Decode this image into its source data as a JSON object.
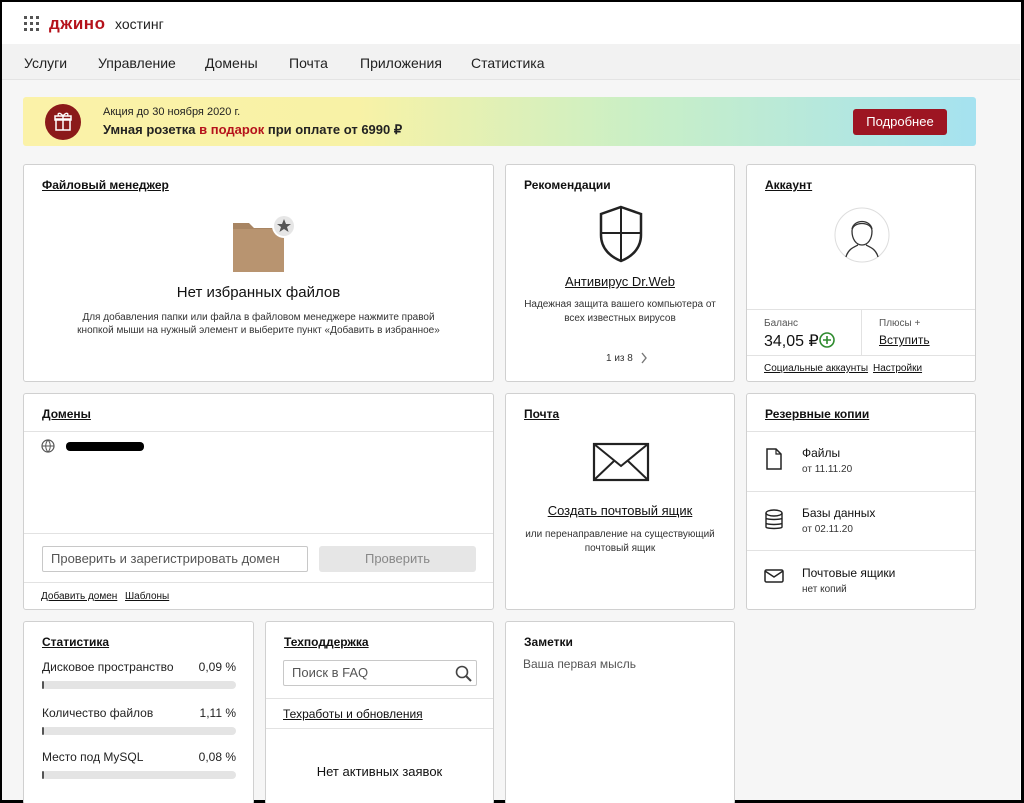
{
  "header": {
    "logo": "джино",
    "logo_sub": "хостинг"
  },
  "nav": {
    "items": [
      "Услуги",
      "Управление",
      "Домены",
      "Почта",
      "Приложения",
      "Статистика"
    ]
  },
  "promo": {
    "small": "Акция до 30 ноября 2020 г.",
    "big_prefix": "Умная розетка ",
    "big_highlight": "в подарок",
    "big_suffix": " при оплате от 6990 ₽",
    "button": "Подробнее",
    "colors": {
      "button": "#9d1522",
      "highlight": "#b5121b"
    }
  },
  "file_manager": {
    "title": "Файловый менеджер",
    "empty_title": "Нет избранных файлов",
    "empty_desc_1": "Для добавления папки или файла в файловом менеджере нажмите правой",
    "empty_desc_2": "кнопкой мыши на нужный элемент и выберите пункт «Добавить в избранное»"
  },
  "recommendations": {
    "title": "Рекомендации",
    "item_title": "Антивирус Dr.Web",
    "item_desc_1": "Надежная защита вашего компьютера от",
    "item_desc_2": "всех известных вирусов",
    "pager": "1 из 8"
  },
  "account": {
    "title": "Аккаунт",
    "balance_label": "Баланс",
    "balance_value": "34,05 ₽",
    "plus_label": "Плюсы +",
    "plus_action": "Вступить",
    "link_social": "Социальные аккаунты",
    "link_settings": "Настройки"
  },
  "domains": {
    "title": "Домены",
    "input_placeholder": "Проверить и зарегистрировать домен",
    "check_button": "Проверить",
    "link_add": "Добавить домен",
    "link_templates": "Шаблоны"
  },
  "mail": {
    "title": "Почта",
    "create_link": "Создать почтовый ящик",
    "desc_1": "или перенаправление на существующий",
    "desc_2": "почтовый ящик"
  },
  "backups": {
    "title": "Резервные копии",
    "items": [
      {
        "name": "Файлы",
        "date": "от 11.11.20"
      },
      {
        "name": "Базы данных",
        "date": "от 02.11.20"
      },
      {
        "name": "Почтовые ящики",
        "date": "нет копий"
      }
    ]
  },
  "stats": {
    "title": "Статистика",
    "rows": [
      {
        "label": "Дисковое пространство",
        "value": "0,09 %",
        "fraction": 0.0009
      },
      {
        "label": "Количество файлов",
        "value": "1,11 %",
        "fraction": 0.0111
      },
      {
        "label": "Место под MySQL",
        "value": "0,08 %",
        "fraction": 0.0008
      }
    ]
  },
  "support": {
    "title": "Техподдержка",
    "search_placeholder": "Поиск в FAQ",
    "maintenance_link": "Техработы и обновления",
    "empty": "Нет активных заявок"
  },
  "notes": {
    "title": "Заметки",
    "placeholder": "Ваша первая мысль"
  }
}
